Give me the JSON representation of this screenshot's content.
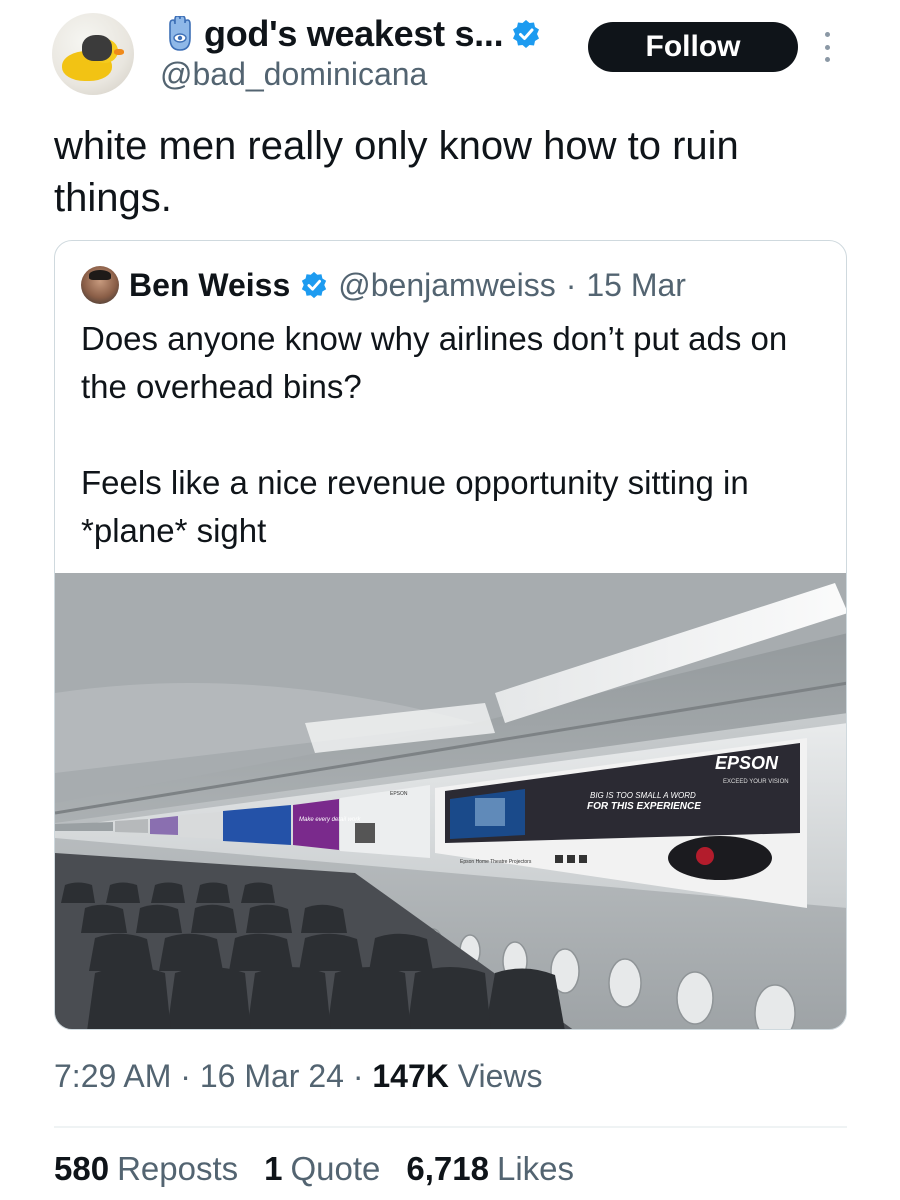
{
  "author": {
    "display_name": "god's weakest s...",
    "handle": "@bad_dominicana",
    "follow_label": "Follow"
  },
  "tweet": {
    "text": "white men really only know how to ruin things."
  },
  "quoted_tweet": {
    "author_name": "Ben Weiss",
    "author_handle": "@benjamweiss",
    "separator": "·",
    "date": "15 Mar",
    "paragraphs": [
      "Does anyone know why airlines don’t put ads on the overhead bins?",
      "Feels like a nice revenue opportunity sitting in *plane* sight"
    ],
    "image": {
      "brand": "EPSON",
      "brand_tagline": "EXCEED YOUR VISION",
      "headline_1": "BIG IS TOO SMALL A WORD",
      "headline_2": "FOR THIS EXPERIENCE",
      "product_caption": "Epson Home Theatre Projectors",
      "small_ad_brand": "EPSON",
      "small_ad_text": "Make every detail work"
    }
  },
  "meta": {
    "time": "7:29 AM",
    "sep": "·",
    "date": "16 Mar 24",
    "views_count": "147K",
    "views_label": "Views"
  },
  "stats": {
    "reposts_count": "580",
    "reposts_label": "Reposts",
    "quotes_count": "1",
    "quotes_label": "Quote",
    "likes_count": "6,718",
    "likes_label": "Likes"
  },
  "colors": {
    "text": "#0f1419",
    "secondary": "#536471",
    "verified": "#1d9bf0",
    "epson_blue": "#1e3d8f",
    "border": "#cfd9de"
  },
  "icons": [
    "hamsa-icon",
    "verified-badge-icon",
    "more-options-icon"
  ]
}
